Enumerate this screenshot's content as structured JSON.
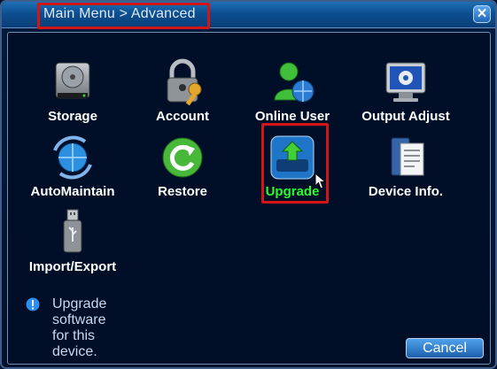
{
  "title": "Main Menu > Advanced",
  "close_icon": "close-icon",
  "menu_items": [
    {
      "label": "Storage",
      "icon": "hard-disk-icon"
    },
    {
      "label": "Account",
      "icon": "padlock-key-icon"
    },
    {
      "label": "Online User",
      "icon": "user-globe-icon"
    },
    {
      "label": "Output Adjust",
      "icon": "monitor-gear-icon"
    },
    {
      "label": "AutoMaintain",
      "icon": "globe-refresh-icon"
    },
    {
      "label": "Restore",
      "icon": "restore-arrow-icon"
    },
    {
      "label": "Upgrade",
      "icon": "upload-tray-icon",
      "selected": true
    },
    {
      "label": "Device Info.",
      "icon": "device-document-icon"
    },
    {
      "label": "Import/Export",
      "icon": "usb-drive-icon"
    }
  ],
  "hint": "Upgrade software for this device.",
  "cancel_label": "Cancel",
  "colors": {
    "background": "#02122e",
    "titlebar": "#0c4f91",
    "highlight": "#d41518",
    "selected_text": "#24ff2a"
  }
}
